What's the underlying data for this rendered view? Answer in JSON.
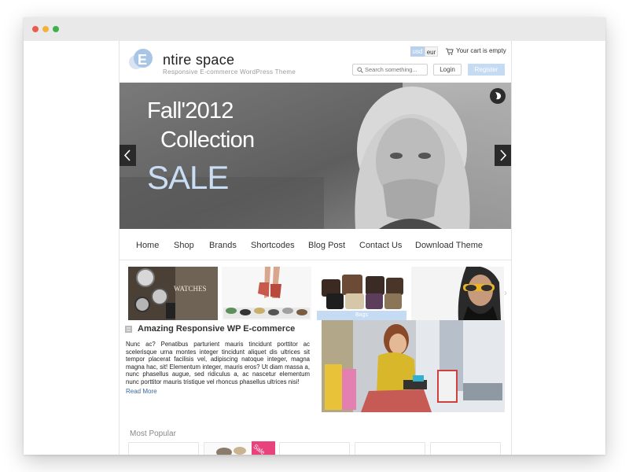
{
  "brand": {
    "title": "ntire space",
    "tagline": "Responsive E-commerce WordPress Theme",
    "logo_icon": "e-logo-icon"
  },
  "header": {
    "currencies": [
      "usd",
      "eur"
    ],
    "selected_currency": "usd",
    "cart_text": "Your cart is empty",
    "search_placeholder": "Search something...",
    "login_label": "Login",
    "register_label": "Register"
  },
  "hero": {
    "line1": "Fall'2012",
    "line2": "Collection",
    "line3": "SALE"
  },
  "nav": {
    "items": [
      "Home",
      "Shop",
      "Brands",
      "Shortcodes",
      "Blog Post",
      "Contact Us",
      "Download Theme"
    ]
  },
  "products": {
    "thumbs": [
      "watches",
      "shoes",
      "bags",
      "sunglasses"
    ],
    "watches_label": "WATCHES",
    "bags_caption": "Bags"
  },
  "article": {
    "title": "Amazing Responsive WP E-commerce",
    "body": "Nunc ac? Penatibus parturient mauris tincidunt porttitor ac scelerisque urna montes integer tincidunt aliquet dis ultrices sit tempor placerat facilisis vel, adipiscing natoque integer, magna magna hac, sit! Elementum integer, mauris eros? Ut diam massa a, nunc phasellus augue, sed ridiculus a, ac nascetur elementum nunc porttitor mauris tristique vel rhoncus phasellus ultrices nisi!",
    "read_more": "Read More"
  },
  "most_popular": {
    "title": "Most Popular",
    "sale_tag": "Sale"
  },
  "colors": {
    "accent": "#c4dbf3",
    "sale": "#e8437c",
    "link": "#3b6a9f"
  }
}
